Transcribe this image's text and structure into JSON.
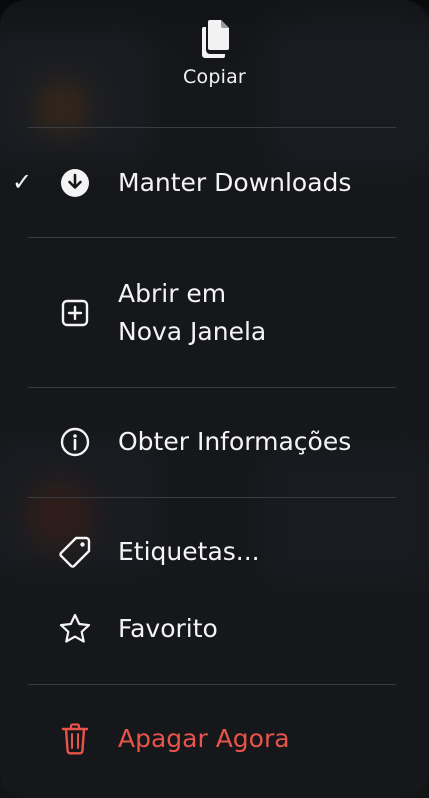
{
  "menu": {
    "copy": {
      "label": "Copiar",
      "icon": "copy-icon"
    },
    "items": [
      {
        "label": "Manter Downloads",
        "icon": "download-circle-icon",
        "checked": true,
        "check_glyph": "✓"
      },
      {
        "label_line1": "Abrir em",
        "label_line2": "Nova Janela",
        "icon": "plus-square-icon"
      },
      {
        "label": "Obter Informações",
        "icon": "info-circle-icon"
      },
      {
        "label": "Etiquetas...",
        "icon": "tag-icon"
      },
      {
        "label": "Favorito",
        "icon": "star-icon"
      },
      {
        "label": "Apagar Agora",
        "icon": "trash-icon",
        "destructive": true
      }
    ]
  },
  "colors": {
    "text": "#f4f4f5",
    "destructive": "#e8534a",
    "divider": "#3a3c40",
    "menu_bg": "#16181b"
  }
}
